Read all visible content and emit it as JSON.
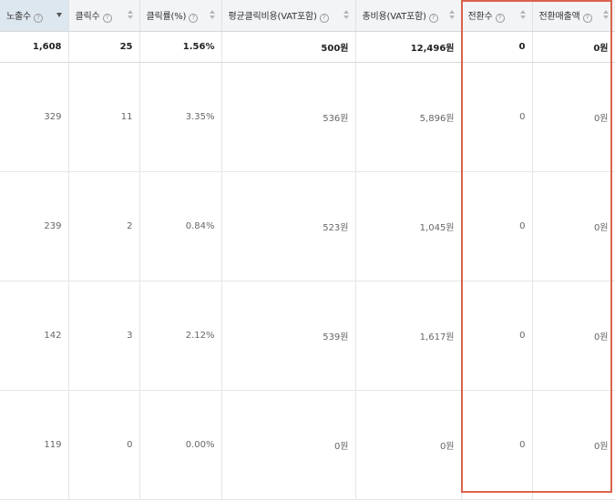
{
  "columns": [
    {
      "label": "노출수",
      "sorted": true
    },
    {
      "label": "클릭수",
      "sorted": false
    },
    {
      "label": "클릭률(%)",
      "sorted": false
    },
    {
      "label": "평균클릭비용(VAT포함)",
      "sorted": false
    },
    {
      "label": "총비용(VAT포함)",
      "sorted": false
    },
    {
      "label": "전환수",
      "sorted": false
    },
    {
      "label": "전환매출액",
      "sorted": false
    }
  ],
  "help_glyph": "?",
  "total": [
    "1,608",
    "25",
    "1.56%",
    "500원",
    "12,496원",
    "0",
    "0원"
  ],
  "rows": [
    [
      "329",
      "11",
      "3.35%",
      "536원",
      "5,896원",
      "0",
      "0원"
    ],
    [
      "239",
      "2",
      "0.84%",
      "523원",
      "1,045원",
      "0",
      "0원"
    ],
    [
      "142",
      "3",
      "2.12%",
      "539원",
      "1,617원",
      "0",
      "0원"
    ],
    [
      "119",
      "0",
      "0.00%",
      "0원",
      "0원",
      "0",
      "0원"
    ]
  ],
  "highlight_color": "#d9634a"
}
